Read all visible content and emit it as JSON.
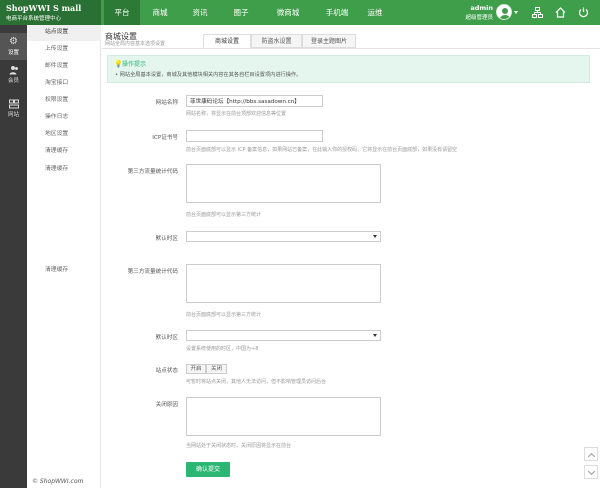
{
  "brand": {
    "line1": "ShopWWI S mall",
    "line2": "电商平台系统管理中心"
  },
  "topnav": [
    {
      "label": "平台",
      "active": true
    },
    {
      "label": "商城",
      "active": false
    },
    {
      "label": "资讯",
      "active": false
    },
    {
      "label": "圈子",
      "active": false
    },
    {
      "label": "微商城",
      "active": false
    },
    {
      "label": "手机端",
      "active": false
    },
    {
      "label": "运维",
      "active": false
    }
  ],
  "user": {
    "name": "admin",
    "role": "超级管理员"
  },
  "sidebar": [
    {
      "label": "设置",
      "icon": "gear-icon",
      "active": true
    },
    {
      "label": "会员",
      "icon": "members-icon",
      "active": false
    },
    {
      "label": "网站",
      "icon": "site-icon",
      "active": false
    }
  ],
  "submenu": [
    "站点设置",
    "上传设置",
    "邮件设置",
    "淘宝接口",
    "权限设置",
    "操作日志",
    "地区设置",
    "清理缓存",
    "清理缓存",
    "清理缓存"
  ],
  "copyright": "© ShopWWI.com",
  "page": {
    "title": "商城设置",
    "subtitle": "网站全局内容基本选项设置"
  },
  "tabs": [
    "商城设置",
    "防盗水设置",
    "登录主题图片"
  ],
  "notice": {
    "title": "操作提示",
    "text": "• 网站全局基本设置，商城及其他模块相关内容在其各自栏目设置项内进行操作。"
  },
  "form": {
    "site_name_label": "网站名称",
    "site_name_value": "菲世康码论坛【http://bbs.sasadown.cn】",
    "site_name_hint": "网站名称，将显示在前台顶部欢迎信息等位置",
    "icp_label": "ICP证书号",
    "icp_hint": "前台页面底部可以显示 ICP 备案信息，如果网站已备案，在此输入你的授权码，它将显示在前台页面底部，如果没有请留空",
    "stat_code_label": "第三方流量统计代码",
    "stat_code_hint": "前台页面底部可以显示第三方统计",
    "timezone_label": "默认时区",
    "stat_code2_label": "第三方流量统计代码",
    "stat_code2_hint": "前台页面底部可以显示第三方统计",
    "timezone2_label": "默认时区",
    "timezone2_hint": "设置系统使用的时区，中国为+8",
    "status_label": "站点状态",
    "status_on": "开启",
    "status_off": "关闭",
    "status_hint": "可暂时将站点关闭，其他人无法访问，但不影响管理员访问后台",
    "close_reason_label": "关闭原因",
    "close_reason_hint": "当网站处于关闭状态时，关闭原因将显示在前台",
    "submit_label": "确认提交"
  },
  "colors": {
    "topbar": "#3f9e4a",
    "accent": "#2bb673",
    "sidebar": "#3a3a3a"
  }
}
